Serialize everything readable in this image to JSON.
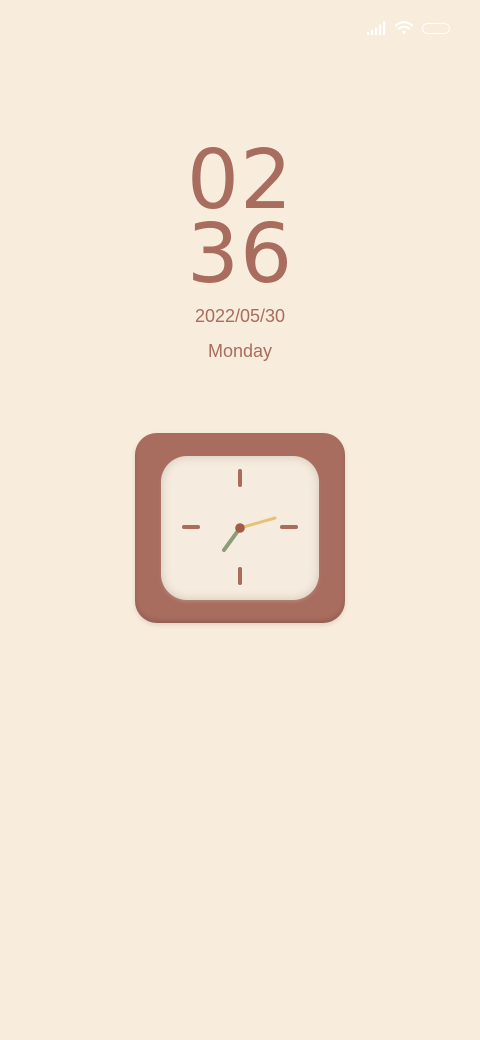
{
  "lockscreen": {
    "hour": "02",
    "minute": "36",
    "date": "2022/05/30",
    "weekday": "Monday"
  },
  "status_bar": {
    "signal_icon": "cellular-signal-icon",
    "wifi_icon": "wifi-icon",
    "battery_icon": "battery-icon"
  },
  "analog_clock": {
    "hour": 2,
    "minute": 36,
    "second": 12
  },
  "colors": {
    "background": "#f8ecdc",
    "accent": "#a86d5e",
    "face": "#f5ecdf",
    "hour_hand": "#8a9c7a",
    "minute_hand": "#e8c078",
    "center": "#a15b4a",
    "status_icons": "#ffffff"
  }
}
